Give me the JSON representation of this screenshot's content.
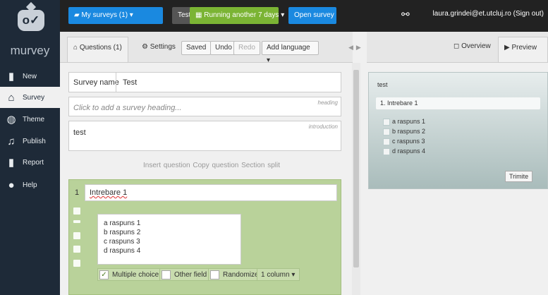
{
  "brand": {
    "name": "murvey",
    "mark": "o✓"
  },
  "sidebar": {
    "items": [
      {
        "label": "New",
        "icon": "new-icon",
        "glyph": "▮"
      },
      {
        "label": "Survey",
        "icon": "survey-icon",
        "glyph": "⌂"
      },
      {
        "label": "Theme",
        "icon": "theme-icon",
        "glyph": "◍"
      },
      {
        "label": "Publish",
        "icon": "publish-icon",
        "glyph": "♫"
      },
      {
        "label": "Report",
        "icon": "report-icon",
        "glyph": "▮"
      },
      {
        "label": "Help",
        "icon": "help-icon",
        "glyph": "●"
      }
    ]
  },
  "topbar": {
    "my_surveys": "My surveys (1)",
    "test": "Test",
    "running": "Running another 7 days",
    "open": "Open survey",
    "user": "laura.grindei@et.utcluj.ro (Sign out)"
  },
  "toolbar": {
    "questions_tab": "Questions (1)",
    "settings_tab": "Settings",
    "saved": "Saved",
    "undo": "Undo",
    "redo": "Redo",
    "add_language": "Add language",
    "overview": "Overview",
    "preview": "Preview"
  },
  "editor": {
    "survey_name_label": "Survey name",
    "survey_name": "Test",
    "heading_placeholder": "Click to add a survey heading...",
    "heading_tag": "heading",
    "introduction_tag": "introduction",
    "introduction": "test",
    "insert_question": "Insert question",
    "copy_question": "Copy question",
    "section_split": "Section split"
  },
  "question": {
    "number": "1",
    "title": "Intrebare 1",
    "answers": [
      "a raspuns 1",
      "b raspuns 2",
      "c raspuns 3",
      "d raspuns 4"
    ],
    "multiple_choice": "Multiple choice",
    "other_field": "Other field",
    "randomize": "Randomize",
    "columns": "1 column"
  },
  "preview": {
    "intro": "test",
    "question": "1. Intrebare 1",
    "options": [
      "a raspuns 1",
      "b raspuns 2",
      "c raspuns 3",
      "d raspuns 4"
    ],
    "submit": "Trimite"
  },
  "colors": {
    "accent": "#1a89e0",
    "running": "#7bb434",
    "question_panel": "#b9d29a",
    "sidebar": "#1e2a38"
  }
}
